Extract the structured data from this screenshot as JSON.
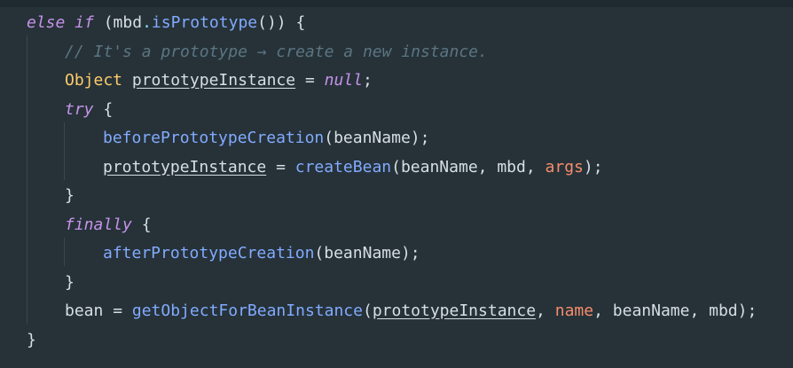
{
  "editor": {
    "lines": [
      {
        "tokens": [
          {
            "t": "else if",
            "c": "kw-italic"
          },
          {
            "t": " (",
            "c": "plain"
          },
          {
            "t": "mbd",
            "c": "plain"
          },
          {
            "t": ".",
            "c": "punct"
          },
          {
            "t": "isPrototype",
            "c": "method"
          },
          {
            "t": "()) {",
            "c": "plain"
          }
        ]
      },
      {
        "tokens": [
          {
            "t": "// It's a prototype → create a new instance.",
            "c": "comment"
          }
        ]
      },
      {
        "tokens": [
          {
            "t": "Object",
            "c": "type"
          },
          {
            "t": " ",
            "c": "plain"
          },
          {
            "t": "prototypeInstance",
            "c": "field"
          },
          {
            "t": " = ",
            "c": "plain"
          },
          {
            "t": "null",
            "c": "nullv"
          },
          {
            "t": ";",
            "c": "plain"
          }
        ]
      },
      {
        "tokens": [
          {
            "t": "try",
            "c": "kw-italic"
          },
          {
            "t": " {",
            "c": "plain"
          }
        ]
      },
      {
        "tokens": [
          {
            "t": "beforePrototypeCreation",
            "c": "method"
          },
          {
            "t": "(beanName);",
            "c": "plain"
          }
        ]
      },
      {
        "tokens": [
          {
            "t": "prototypeInstance",
            "c": "field"
          },
          {
            "t": " = ",
            "c": "plain"
          },
          {
            "t": "createBean",
            "c": "method"
          },
          {
            "t": "(beanName, mbd, ",
            "c": "plain"
          },
          {
            "t": "args",
            "c": "param"
          },
          {
            "t": ");",
            "c": "plain"
          }
        ]
      },
      {
        "tokens": [
          {
            "t": "}",
            "c": "plain"
          }
        ]
      },
      {
        "tokens": [
          {
            "t": "finally",
            "c": "kw-italic"
          },
          {
            "t": " {",
            "c": "plain"
          }
        ]
      },
      {
        "tokens": [
          {
            "t": "afterPrototypeCreation",
            "c": "method"
          },
          {
            "t": "(beanName);",
            "c": "plain"
          }
        ]
      },
      {
        "tokens": [
          {
            "t": "}",
            "c": "plain"
          }
        ]
      },
      {
        "tokens": [
          {
            "t": "bean",
            "c": "plain"
          },
          {
            "t": " = ",
            "c": "plain"
          },
          {
            "t": "getObjectForBeanInstance",
            "c": "method"
          },
          {
            "t": "(",
            "c": "plain"
          },
          {
            "t": "prototypeInstance",
            "c": "field"
          },
          {
            "t": ", ",
            "c": "plain"
          },
          {
            "t": "name",
            "c": "param"
          },
          {
            "t": ", beanName, mbd);",
            "c": "plain"
          }
        ]
      },
      {
        "tokens": [
          {
            "t": "}",
            "c": "plain"
          }
        ]
      }
    ]
  },
  "colors": {
    "background": "#263238",
    "keyword": "#c792ea",
    "type": "#ffcb6b",
    "method": "#82aaff",
    "comment": "#5c7582",
    "parameter": "#f78c6c",
    "text": "#d7dee6"
  }
}
